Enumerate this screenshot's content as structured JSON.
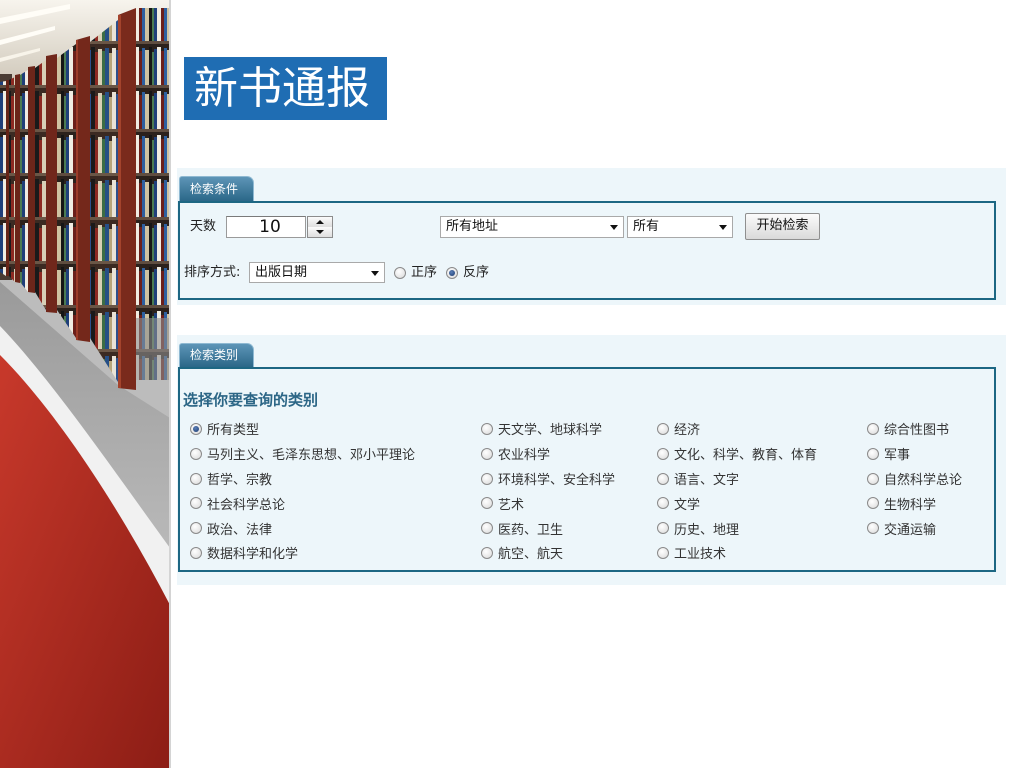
{
  "slide": {
    "title": "新书通报"
  },
  "search_conditions": {
    "tab_label": "检索条件",
    "days_label": "天数",
    "days_value": "10",
    "address_select": {
      "selected": "所有地址"
    },
    "scope_select": {
      "selected": "所有"
    },
    "search_button": "开始检索",
    "sort_label": "排序方式:",
    "sort_select": {
      "selected": "出版日期"
    },
    "order_options": [
      {
        "label": "正序",
        "checked": false
      },
      {
        "label": "反序",
        "checked": true
      }
    ]
  },
  "category_search": {
    "tab_label": "检索类别",
    "heading": "选择你要查询的类别",
    "columns": [
      [
        {
          "label": "所有类型",
          "checked": true
        },
        {
          "label": "马列主义、毛泽东思想、邓小平理论",
          "checked": false
        },
        {
          "label": "哲学、宗教",
          "checked": false
        },
        {
          "label": "社会科学总论",
          "checked": false
        },
        {
          "label": "政治、法律",
          "checked": false
        },
        {
          "label": "数据科学和化学",
          "checked": false
        }
      ],
      [
        {
          "label": "天文学、地球科学",
          "checked": false
        },
        {
          "label": "农业科学",
          "checked": false
        },
        {
          "label": "环境科学、安全科学",
          "checked": false
        },
        {
          "label": "艺术",
          "checked": false
        },
        {
          "label": "医药、卫生",
          "checked": false
        },
        {
          "label": "航空、航天",
          "checked": false
        }
      ],
      [
        {
          "label": "经济",
          "checked": false
        },
        {
          "label": "文化、科学、教育、体育",
          "checked": false
        },
        {
          "label": "语言、文字",
          "checked": false
        },
        {
          "label": "文学",
          "checked": false
        },
        {
          "label": "历史、地理",
          "checked": false
        },
        {
          "label": "工业技术",
          "checked": false
        }
      ],
      [
        {
          "label": "综合性图书",
          "checked": false
        },
        {
          "label": "军事",
          "checked": false
        },
        {
          "label": "自然科学总论",
          "checked": false
        },
        {
          "label": "生物科学",
          "checked": false
        },
        {
          "label": "交通运输",
          "checked": false
        }
      ]
    ]
  },
  "icons": {
    "spinner_up": "spinner-up-icon",
    "spinner_down": "spinner-down-icon",
    "dropdown": "chevron-down-icon",
    "radio": "radio-icon"
  },
  "colors": {
    "title_bg": "#1f6db3",
    "panel_bg": "#edf6fa",
    "panel_border": "#1d6783",
    "tab_bg": "#2b6788",
    "heading": "#2c6686",
    "decor_red": "#b02a1e"
  }
}
